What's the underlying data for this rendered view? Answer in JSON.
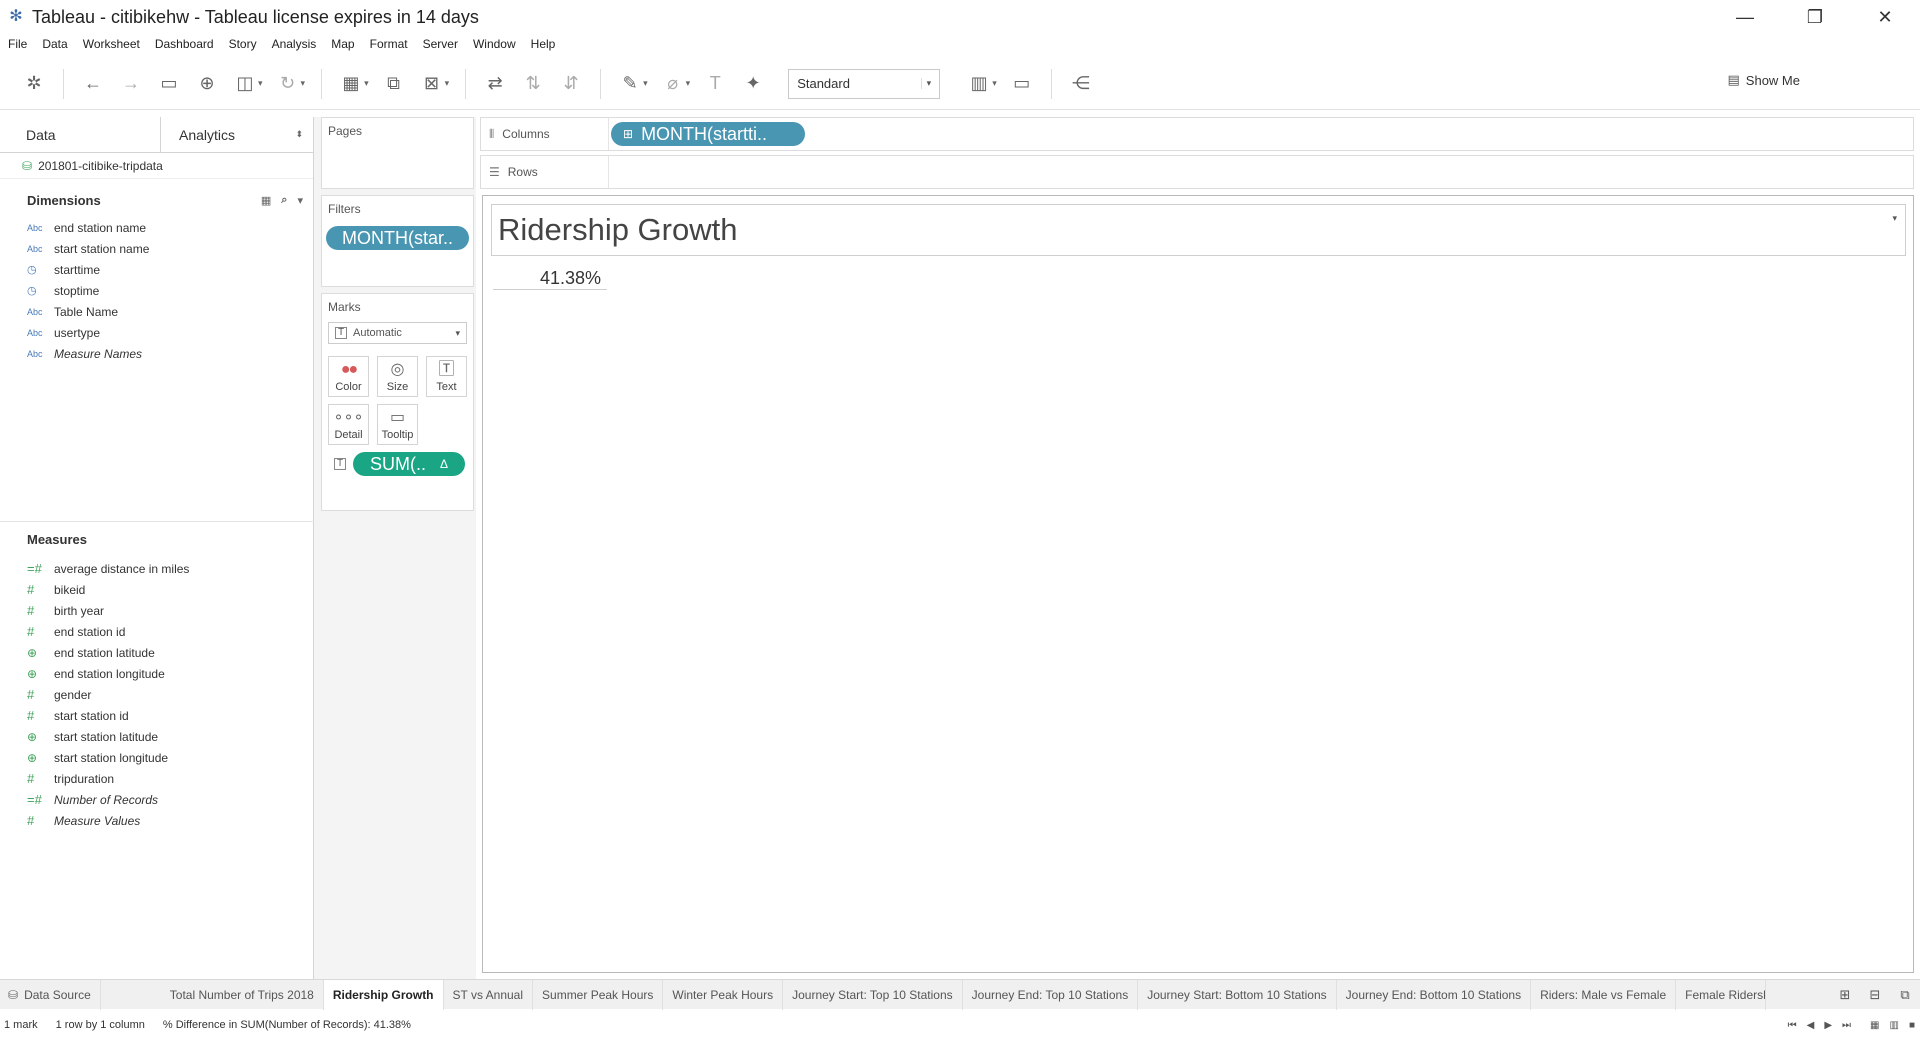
{
  "window": {
    "title": "Tableau - citibikehw - Tableau license expires in 14 days",
    "minimize": "—",
    "restore": "❐",
    "close": "✕"
  },
  "menu": [
    "File",
    "Data",
    "Worksheet",
    "Dashboard",
    "Story",
    "Analysis",
    "Map",
    "Format",
    "Server",
    "Window",
    "Help"
  ],
  "toolbar": {
    "view_select": "Standard",
    "show_me": "Show Me"
  },
  "data_pane": {
    "tabs": {
      "data": "Data",
      "analytics": "Analytics"
    },
    "datasource": "201801-citibike-tripdata",
    "dimensions_title": "Dimensions",
    "dimensions": [
      {
        "type": "Abc",
        "name": "end station name"
      },
      {
        "type": "Abc",
        "name": "start station name"
      },
      {
        "type": "date",
        "name": "starttime"
      },
      {
        "type": "date",
        "name": "stoptime"
      },
      {
        "type": "Abc",
        "name": "Table Name"
      },
      {
        "type": "Abc",
        "name": "usertype"
      },
      {
        "type": "Abc",
        "name": "Measure Names"
      }
    ],
    "measures_title": "Measures",
    "measures": [
      {
        "type": "#",
        "name": "average distance in miles"
      },
      {
        "type": "#",
        "name": "bikeid"
      },
      {
        "type": "#",
        "name": "birth year"
      },
      {
        "type": "#",
        "name": "end station id"
      },
      {
        "type": "geo",
        "name": "end station latitude"
      },
      {
        "type": "geo",
        "name": "end station longitude"
      },
      {
        "type": "#",
        "name": "gender"
      },
      {
        "type": "#",
        "name": "start station id"
      },
      {
        "type": "geo",
        "name": "start station latitude"
      },
      {
        "type": "geo",
        "name": "start station longitude"
      },
      {
        "type": "#",
        "name": "tripduration"
      },
      {
        "type": "#",
        "name": "Number of Records"
      },
      {
        "type": "#",
        "name": "Measure Values"
      }
    ]
  },
  "cards": {
    "pages_title": "Pages",
    "filters_title": "Filters",
    "filter_pill": "MONTH(star..",
    "marks_title": "Marks",
    "marks_type": "Automatic",
    "mark_buttons": {
      "color": "Color",
      "size": "Size",
      "text": "Text",
      "detail": "Detail",
      "tooltip": "Tooltip"
    },
    "marks_pill": "SUM(..",
    "marks_pill_delta": "Δ"
  },
  "shelves": {
    "columns_label": "Columns",
    "columns_pill": "MONTH(startti..",
    "rows_label": "Rows"
  },
  "view": {
    "title": "Ridership Growth",
    "value": "41.38%"
  },
  "sheet_tabs": {
    "data_source": "Data Source",
    "sheets": [
      "Total Number of Trips 2018",
      "Ridership Growth",
      "ST vs Annual",
      "Summer Peak Hours",
      "Winter Peak Hours",
      "Journey Start: Top 10 Stations",
      "Journey End: Top 10 Stations",
      "Journey Start: Bottom 10 Stations",
      "Journey End: Bottom 10 Stations",
      "Riders: Male vs Female",
      "Female Ridership"
    ],
    "active": "Ridership Growth"
  },
  "status": {
    "marks": "1 mark",
    "rows_cols": "1 row by 1 column",
    "summary": "% Difference in SUM(Number of Records): 41.38%"
  }
}
